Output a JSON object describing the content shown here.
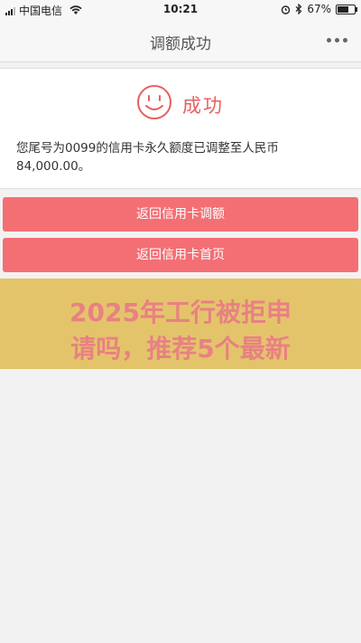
{
  "status_bar": {
    "carrier": "中国电信",
    "time": "10:21",
    "battery": "67%",
    "battery_level": 0.67
  },
  "nav": {
    "title": "调额成功",
    "more_icon": "more-dots-icon"
  },
  "result": {
    "icon": "smile-icon",
    "status": "成功",
    "message": "您尾号为0099的信用卡永久额度已调整至人民币 84,000.00。"
  },
  "actions": {
    "back_adjust_label": "返回信用卡调额",
    "back_home_label": "返回信用卡首页"
  },
  "overlay": {
    "line1": "2025年工行被拒申",
    "line2": "请吗，推荐5个最新"
  },
  "colors": {
    "accent": "#f36f74",
    "success": "#e85f5f",
    "banner_bg": "#e3c160",
    "banner_text": "#e8787a"
  }
}
